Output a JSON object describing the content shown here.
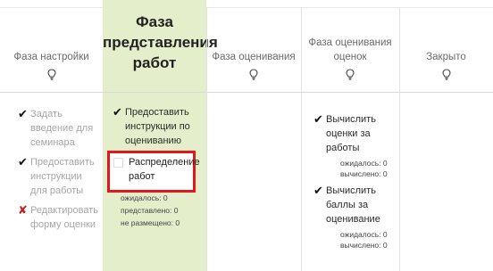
{
  "phases": [
    {
      "name": "Фаза настройки",
      "active": false
    },
    {
      "name_lines": [
        "Фаза",
        "представления",
        "работ"
      ],
      "active": true
    },
    {
      "name": "Фаза оценивания",
      "active": false
    },
    {
      "name_lines": [
        "Фаза оценивания",
        "оценок"
      ],
      "active": false
    },
    {
      "name": "Закрыто",
      "active": false
    }
  ],
  "setup_tasks": [
    {
      "lines": [
        "Задать",
        "введение для",
        "семинара"
      ],
      "status": "✔"
    },
    {
      "lines": [
        "Предоставить",
        "инструкции",
        "для работы"
      ],
      "status": "✔"
    },
    {
      "lines": [
        "Редактировать",
        "форму оценки"
      ],
      "status": "✘"
    }
  ],
  "submission": {
    "task1_lines": [
      "Предоставить",
      "инструкции по",
      "оцениванию"
    ],
    "task1_status": "✔",
    "task2_lines": [
      "Распределение",
      "работ"
    ],
    "stats": [
      "ожидалось: 0",
      "представлено: 0",
      "не размещено: 0"
    ]
  },
  "evaluation_of_assessments": {
    "task1_lines": [
      "Вычислить",
      "оценки за",
      "работы"
    ],
    "task1_status": "✔",
    "task1_stats": [
      "ожидалось: 0",
      "вычислено: 0"
    ],
    "task2_lines": [
      "Вычислить",
      "баллы за",
      "оценивание"
    ],
    "task2_status": "✔",
    "task2_stats": [
      "ожидалось: 0",
      "вычислено: 0"
    ]
  },
  "colors": {
    "active_phase_bg": "#e5eecb",
    "highlight_border": "#e0181c",
    "fail_mark": "#c41f1f"
  }
}
